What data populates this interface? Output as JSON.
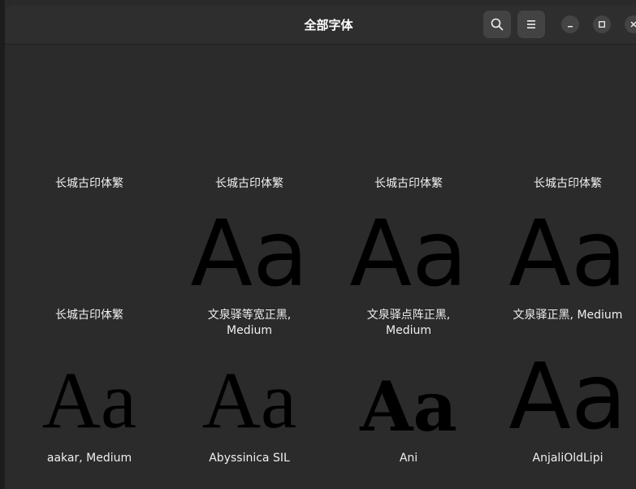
{
  "header": {
    "title": "全部字体"
  },
  "icons": {
    "search": "search-icon",
    "menu": "hamburger-menu-icon",
    "minimize": "minimize-icon",
    "maximize": "maximize-icon",
    "close": "close-icon"
  },
  "colors": {
    "background": "#2a2a2a",
    "headerbar": "#2e2e2e",
    "sample_glyph": "#000000",
    "button": "#434343"
  },
  "fonts": [
    {
      "label": "长城古印体繁",
      "sample": ""
    },
    {
      "label": "长城古印体繁",
      "sample": "Aa"
    },
    {
      "label": "长城古印体繁",
      "sample": "Aa"
    },
    {
      "label": "长城古印体繁",
      "sample": "Aa"
    },
    {
      "label": "长城古印体繁",
      "sample": "Aa"
    },
    {
      "label": "文泉驿等宽正黑,\nMedium",
      "sample": "Aa"
    },
    {
      "label": "文泉驿点阵正黑,\nMedium",
      "sample": "Aa"
    },
    {
      "label": "文泉驿正黑, Medium",
      "sample": "Aa"
    },
    {
      "label": "aakar, Medium",
      "sample": ""
    },
    {
      "label": "Abyssinica SIL",
      "sample": ""
    },
    {
      "label": "Ani",
      "sample": ""
    },
    {
      "label": "AnjaliOldLipi",
      "sample": ""
    }
  ]
}
